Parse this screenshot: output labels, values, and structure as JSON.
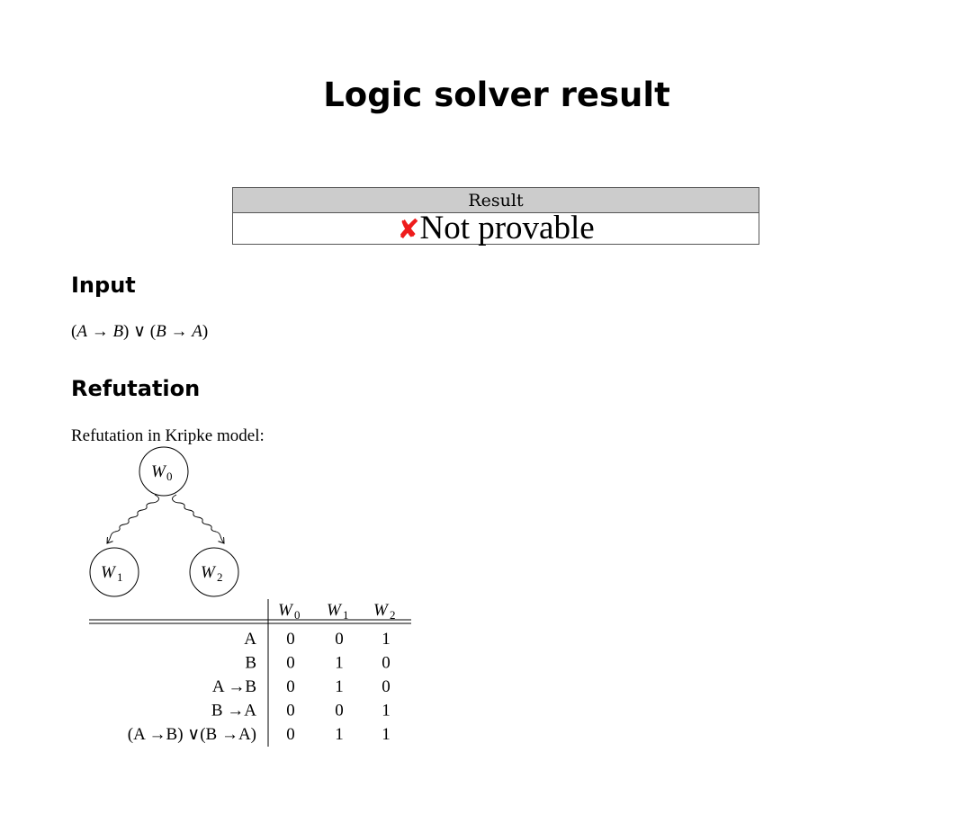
{
  "page": {
    "title": "Logic solver result"
  },
  "result": {
    "header": "Result",
    "icon": "cross-mark-icon",
    "icon_glyph": "✘",
    "icon_color": "#ee1c1c",
    "status": "Not provable"
  },
  "input": {
    "heading": "Input",
    "formula": {
      "open1": "(",
      "a1": "A",
      "arrow1": " → ",
      "b1": "B",
      "close1": ") ∨ (",
      "b2": "B",
      "arrow2": " → ",
      "a2": "A",
      "close2": ")"
    }
  },
  "refutation": {
    "heading": "Refutation",
    "intro": "Refutation in Kripke model:",
    "worlds": [
      {
        "letter": "W",
        "sub": "0"
      },
      {
        "letter": "W",
        "sub": "1"
      },
      {
        "letter": "W",
        "sub": "2"
      }
    ],
    "edges": [
      {
        "from": "W0",
        "to": "W1"
      },
      {
        "from": "W0",
        "to": "W2"
      }
    ],
    "table": {
      "columns": [
        {
          "letter": "W",
          "sub": "0"
        },
        {
          "letter": "W",
          "sub": "1"
        },
        {
          "letter": "W",
          "sub": "2"
        }
      ],
      "rows": [
        {
          "label": "A",
          "values": [
            "0",
            "0",
            "1"
          ]
        },
        {
          "label": "B",
          "values": [
            "0",
            "1",
            "0"
          ]
        },
        {
          "label": "A →B",
          "values": [
            "0",
            "1",
            "0"
          ]
        },
        {
          "label": "B →A",
          "values": [
            "0",
            "0",
            "1"
          ]
        },
        {
          "label": "(A →B) ∨(B →A)",
          "values": [
            "0",
            "1",
            "1"
          ]
        }
      ]
    }
  }
}
